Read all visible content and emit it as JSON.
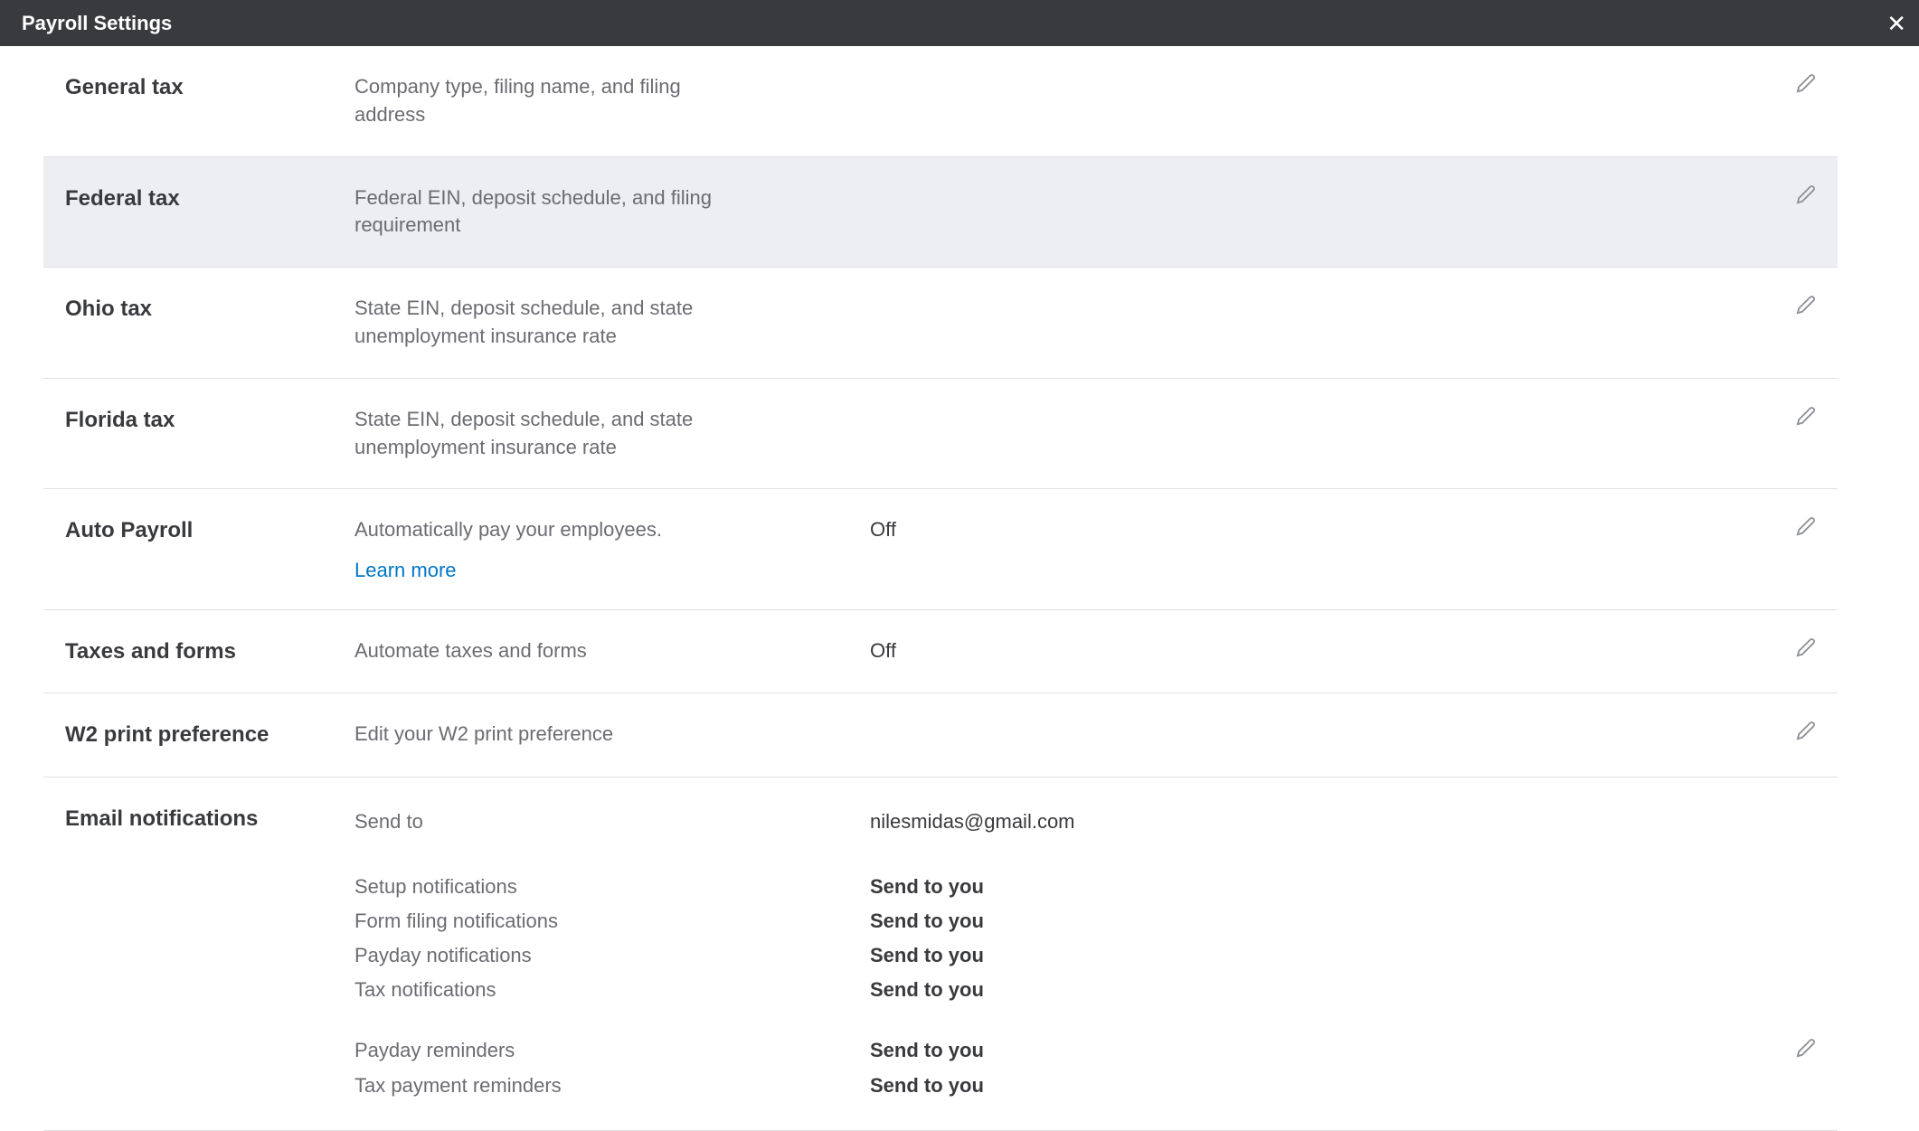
{
  "header": {
    "title": "Payroll Settings"
  },
  "rows": {
    "general_tax": {
      "title": "General tax",
      "desc": "Company type, filing name, and filing address"
    },
    "federal_tax": {
      "title": "Federal tax",
      "desc": "Federal EIN, deposit schedule, and filing requirement"
    },
    "ohio_tax": {
      "title": "Ohio tax",
      "desc": "State EIN, deposit schedule, and state unemployment insurance rate"
    },
    "florida_tax": {
      "title": "Florida tax",
      "desc": "State EIN, deposit schedule, and state unemployment insurance rate"
    },
    "auto_payroll": {
      "title": "Auto Payroll",
      "desc": "Automatically pay your employees.",
      "learn_more": "Learn more",
      "value": "Off"
    },
    "taxes_forms": {
      "title": "Taxes and forms",
      "desc": "Automate taxes and forms",
      "value": "Off"
    },
    "w2_print": {
      "title": "W2 print preference",
      "desc": "Edit your W2 print preference"
    }
  },
  "email_notifications": {
    "title": "Email notifications",
    "send_to_label": "Send to",
    "send_to_value": "nilesmidas@gmail.com",
    "items": {
      "setup": {
        "label": "Setup notifications",
        "value": "Send to you"
      },
      "form_filing": {
        "label": "Form filing notifications",
        "value": "Send to you"
      },
      "payday_notif": {
        "label": "Payday notifications",
        "value": "Send to you"
      },
      "tax_notif": {
        "label": "Tax notifications",
        "value": "Send to you"
      },
      "payday_rem": {
        "label": "Payday reminders",
        "value": "Send to you"
      },
      "tax_payment_rem": {
        "label": "Tax payment reminders",
        "value": "Send to you"
      }
    }
  }
}
